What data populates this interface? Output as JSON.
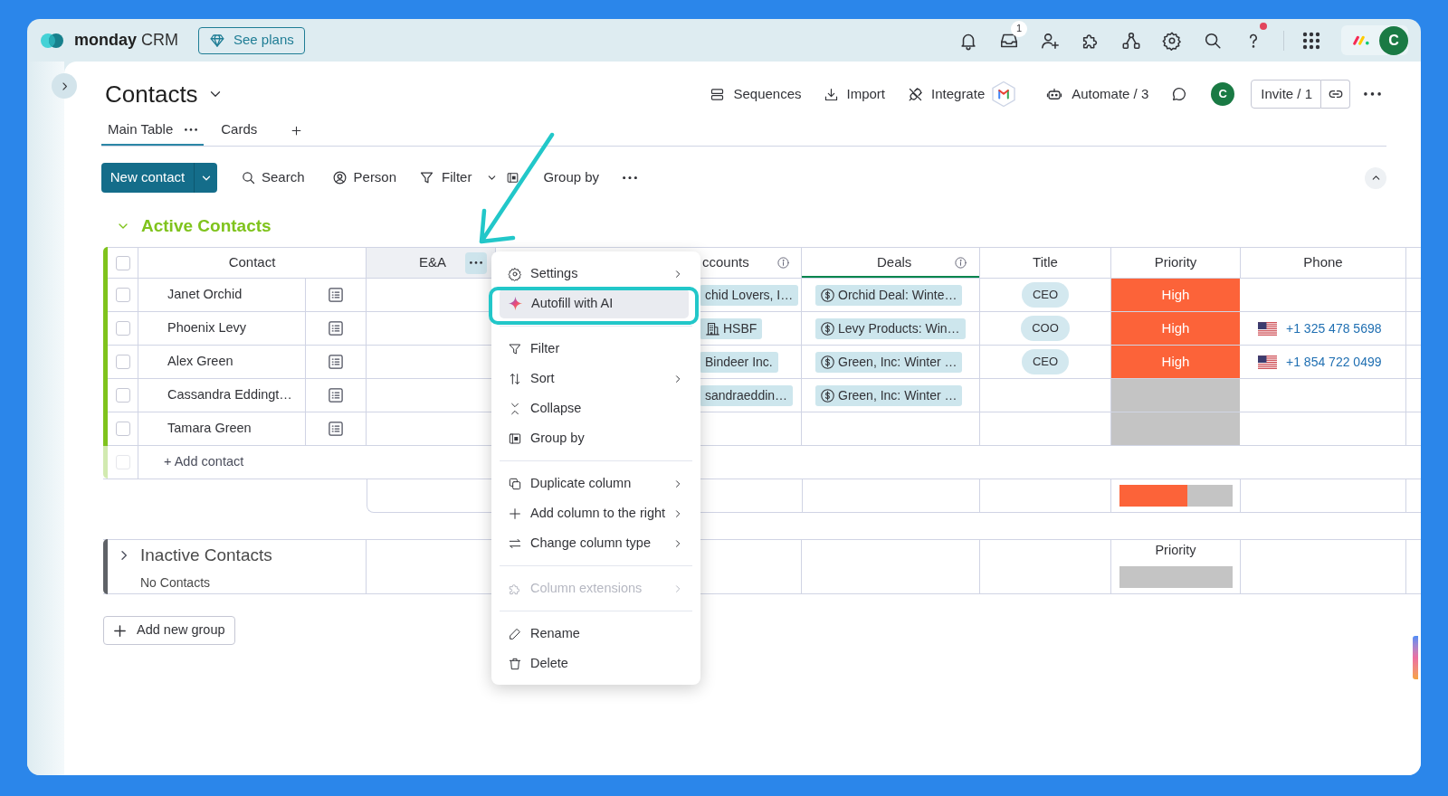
{
  "top_bar": {
    "brand": "monday",
    "product": "CRM",
    "plans_button": "See plans",
    "inbox_badge": "1",
    "help_notification": true,
    "avatar": "C"
  },
  "board": {
    "title": "Contacts",
    "sequences": "Sequences",
    "import": "Import",
    "integrate": "Integrate",
    "automate": "Automate / 3",
    "avatar": "C",
    "invite": "Invite / 1"
  },
  "view_tabs": [
    {
      "label": "Main Table",
      "selected": true
    },
    {
      "label": "Cards",
      "selected": false
    }
  ],
  "toolbar": {
    "new_button": "New contact",
    "search": "Search",
    "person": "Person",
    "filter": "Filter",
    "group_by": "Group by"
  },
  "groups": [
    {
      "title": "Active Contacts",
      "expanded": true,
      "color": "#7fc31c",
      "all_checked": false,
      "columns": [
        {
          "label": "Contact"
        },
        {
          "label": "E&A",
          "menu_open": true
        },
        {
          "label": "ccounts",
          "info": true
        },
        {
          "label": "Deals",
          "info": true,
          "color": "#00854d"
        },
        {
          "label": "Title"
        },
        {
          "label": "Priority"
        },
        {
          "label": "Phone"
        }
      ],
      "rows": [
        {
          "checked": false,
          "contact": "Janet Orchid",
          "account": {
            "text": "chid Lovers, I…",
            "kind": "plain"
          },
          "deal": "Orchid Deal: Winte…",
          "title": "CEO",
          "priority": {
            "label": "High",
            "color": "#fc6339"
          }
        },
        {
          "checked": false,
          "contact": "Phoenix Levy",
          "account": {
            "text": "HSBF",
            "kind": "company"
          },
          "deal": "Levy Products: Win…",
          "title": "COO",
          "priority": {
            "label": "High",
            "color": "#fc6339"
          },
          "phone": "+1 325 478 5698"
        },
        {
          "checked": false,
          "contact": "Alex Green",
          "account": {
            "text": "Bindeer Inc.",
            "kind": "plain"
          },
          "deal": "Green, Inc: Winter …",
          "title": "CEO",
          "priority": {
            "label": "High",
            "color": "#fc6339"
          },
          "phone": "+1 854 722 0499"
        },
        {
          "checked": false,
          "contact": "Cassandra Eddingt…",
          "account": {
            "text": "sandraeddin…",
            "kind": "plain"
          },
          "deal": "Green, Inc: Winter …",
          "priority": {
            "color": "#c4c4c4"
          }
        },
        {
          "checked": false,
          "contact": "Tamara Green",
          "priority": {
            "color": "#c4c4c4"
          }
        }
      ],
      "add_row": {
        "label": "+ Add contact",
        "checked": false,
        "disabled": true
      },
      "priority_summary": {
        "level": 0.6
      }
    },
    {
      "title": "Inactive Contacts",
      "expanded": false,
      "color": "#5f6267",
      "subtitle": "No Contacts",
      "priority_summary": {
        "label": "Priority"
      }
    }
  ],
  "column_menu": {
    "sections": [
      [
        {
          "label": "Settings",
          "kind": "settings",
          "submenu": true,
          "highlighted": false,
          "disabled": false
        },
        {
          "label": "Autofill with AI",
          "kind": "ai",
          "submenu": false,
          "highlighted": true,
          "disabled": false
        }
      ],
      [
        {
          "label": "Filter",
          "kind": "filter",
          "submenu": false,
          "highlighted": false,
          "disabled": false
        },
        {
          "label": "Sort",
          "kind": "sort",
          "submenu": true,
          "highlighted": false,
          "disabled": false
        },
        {
          "label": "Collapse",
          "kind": "collapse",
          "submenu": false,
          "highlighted": false,
          "disabled": false
        },
        {
          "label": "Group by",
          "kind": "group",
          "submenu": false,
          "highlighted": false,
          "disabled": false
        }
      ],
      [
        {
          "label": "Duplicate column",
          "kind": "duplicate",
          "submenu": true,
          "highlighted": false,
          "disabled": false
        },
        {
          "label": "Add column to the right",
          "kind": "add",
          "submenu": true,
          "highlighted": false,
          "disabled": false
        },
        {
          "label": "Change column type",
          "kind": "change",
          "submenu": true,
          "highlighted": false,
          "disabled": false
        }
      ],
      [
        {
          "label": "Column extensions",
          "kind": "extensions",
          "submenu": true,
          "highlighted": false,
          "disabled": true
        }
      ],
      [
        {
          "label": "Rename",
          "kind": "rename",
          "submenu": false,
          "highlighted": false,
          "disabled": false
        },
        {
          "label": "Delete",
          "kind": "delete",
          "submenu": false,
          "highlighted": false,
          "disabled": false
        }
      ]
    ]
  },
  "add_group": "Add new group"
}
